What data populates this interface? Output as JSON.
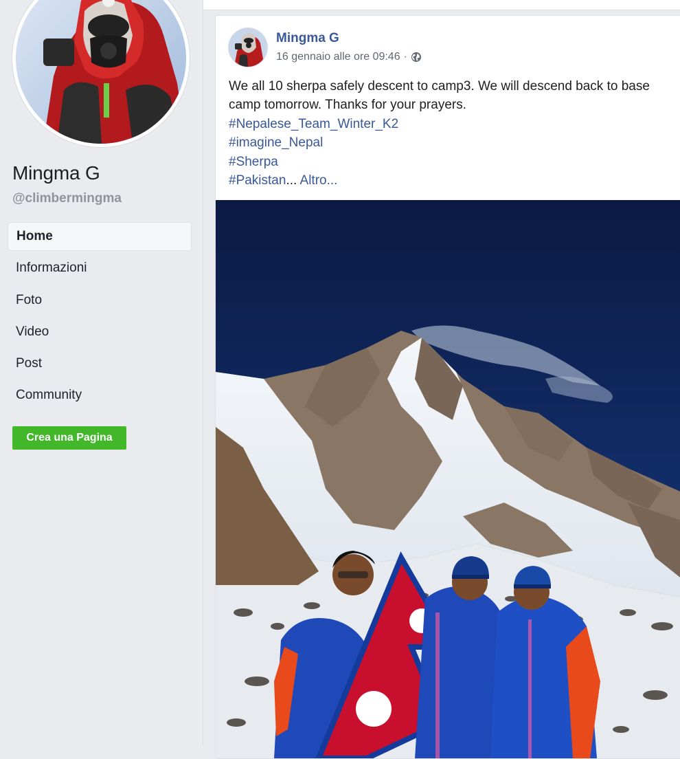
{
  "sidebar": {
    "page_name": "Mingma G",
    "handle": "@climbermingma",
    "nav": [
      {
        "label": "Home",
        "active": true
      },
      {
        "label": "Informazioni",
        "active": false
      },
      {
        "label": "Foto",
        "active": false
      },
      {
        "label": "Video",
        "active": false
      },
      {
        "label": "Post",
        "active": false
      },
      {
        "label": "Community",
        "active": false
      }
    ],
    "create_page_label": "Crea una Pagina"
  },
  "post": {
    "author": "Mingma G",
    "timestamp": "16 gennaio alle ore 09:46",
    "separator": "·",
    "privacy_icon": "globe-icon",
    "text": "We all 10 sherpa safely descent to camp3. We will descend back to base camp tomorrow. Thanks for your prayers.",
    "hashtags": [
      "#Nepalese_Team_Winter_K2",
      "#imagine_Nepal",
      "#Sherpa"
    ],
    "truncated_tag": "#Pakistan",
    "ellipsis": "...",
    "more_label": "Altro..."
  },
  "colors": {
    "link": "#385898",
    "create_button": "#42b72a",
    "background": "#e9ebee",
    "sky": "#0e1f4d"
  }
}
